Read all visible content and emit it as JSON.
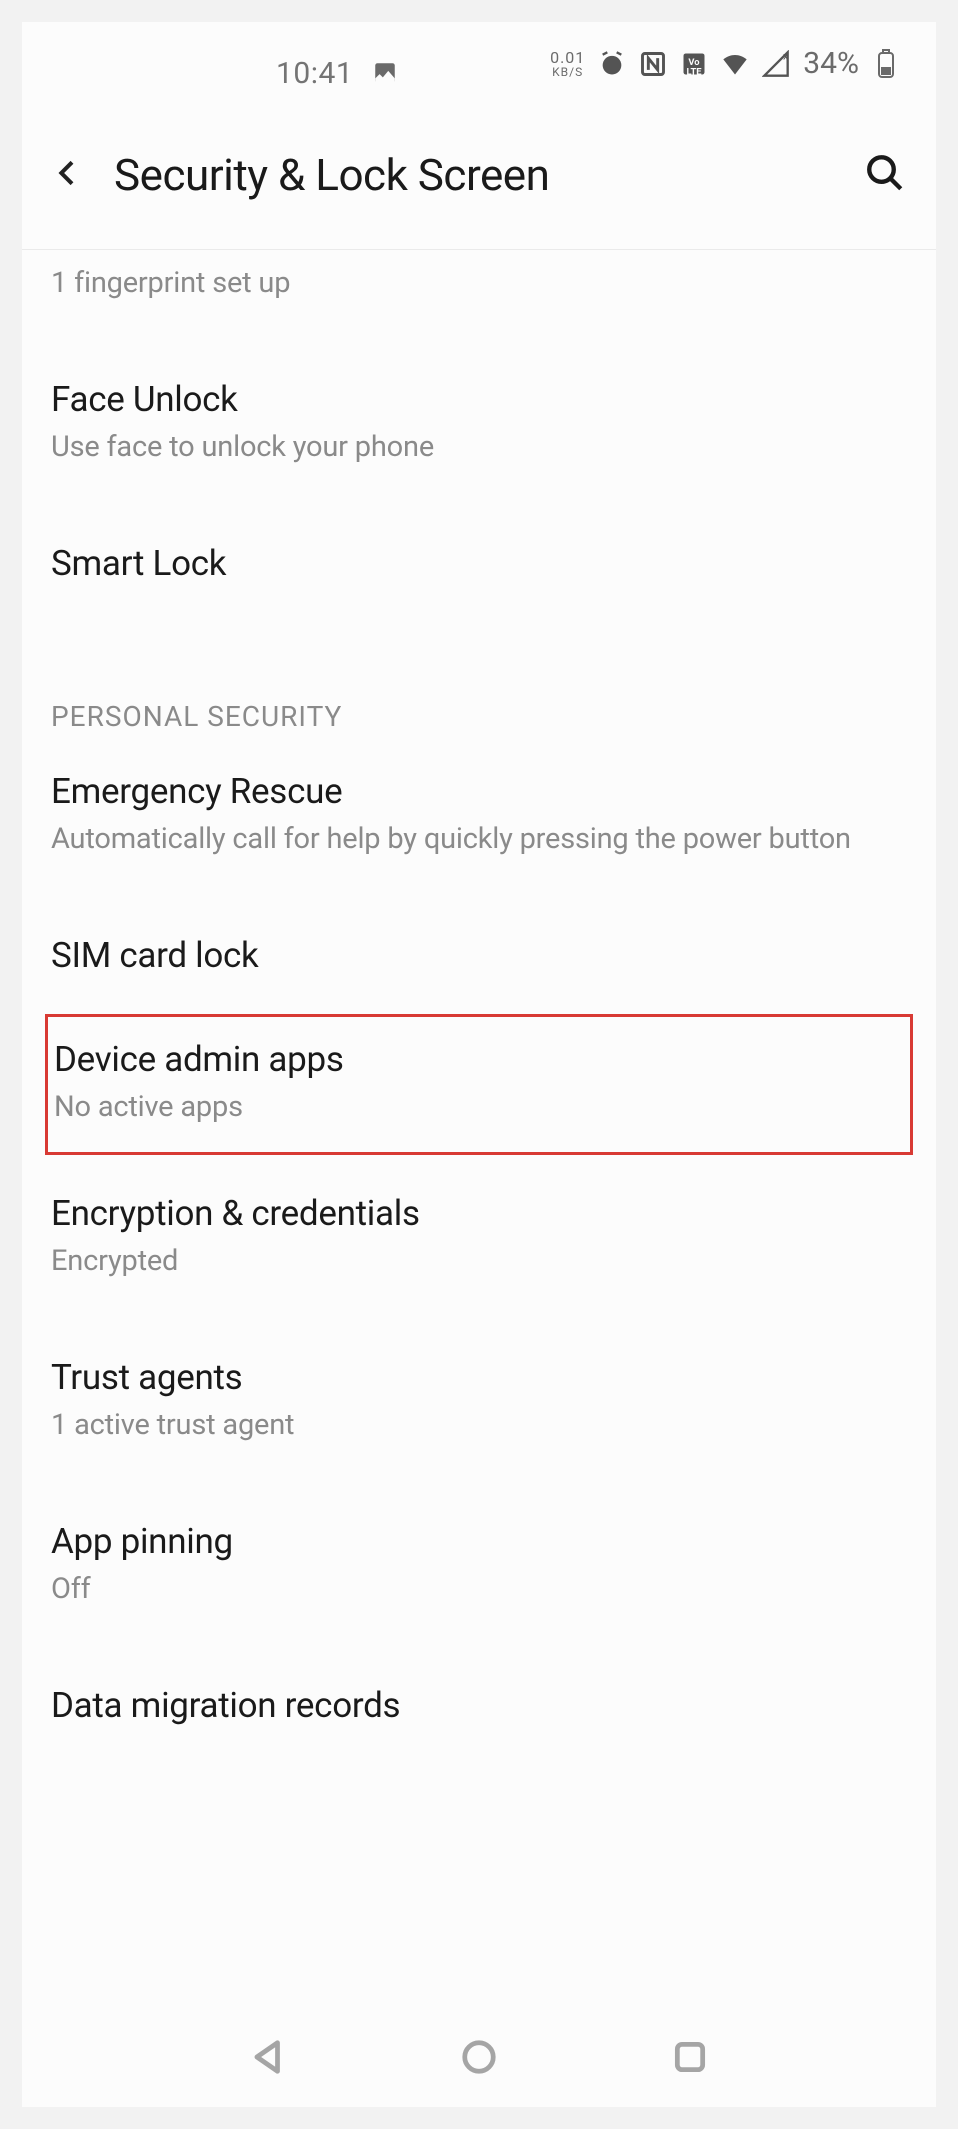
{
  "status": {
    "time": "10:41",
    "net_speed_top": "0.01",
    "net_speed_bot": "KB/S",
    "battery": "34%"
  },
  "header": {
    "title": "Security & Lock Screen"
  },
  "items": {
    "fingerprint_sub": "1 fingerprint set up",
    "face_title": "Face Unlock",
    "face_sub": "Use face to unlock your phone",
    "smartlock_title": "Smart Lock",
    "section_personal": "PERSONAL SECURITY",
    "emergency_title": "Emergency Rescue",
    "emergency_sub": "Automatically call for help by quickly pressing the power button",
    "sim_title": "SIM card lock",
    "admin_title": "Device admin apps",
    "admin_sub": "No active apps",
    "encrypt_title": "Encryption & credentials",
    "encrypt_sub": "Encrypted",
    "trust_title": "Trust agents",
    "trust_sub": "1 active trust agent",
    "pinning_title": "App pinning",
    "pinning_sub": "Off",
    "migration_title": "Data migration records"
  }
}
